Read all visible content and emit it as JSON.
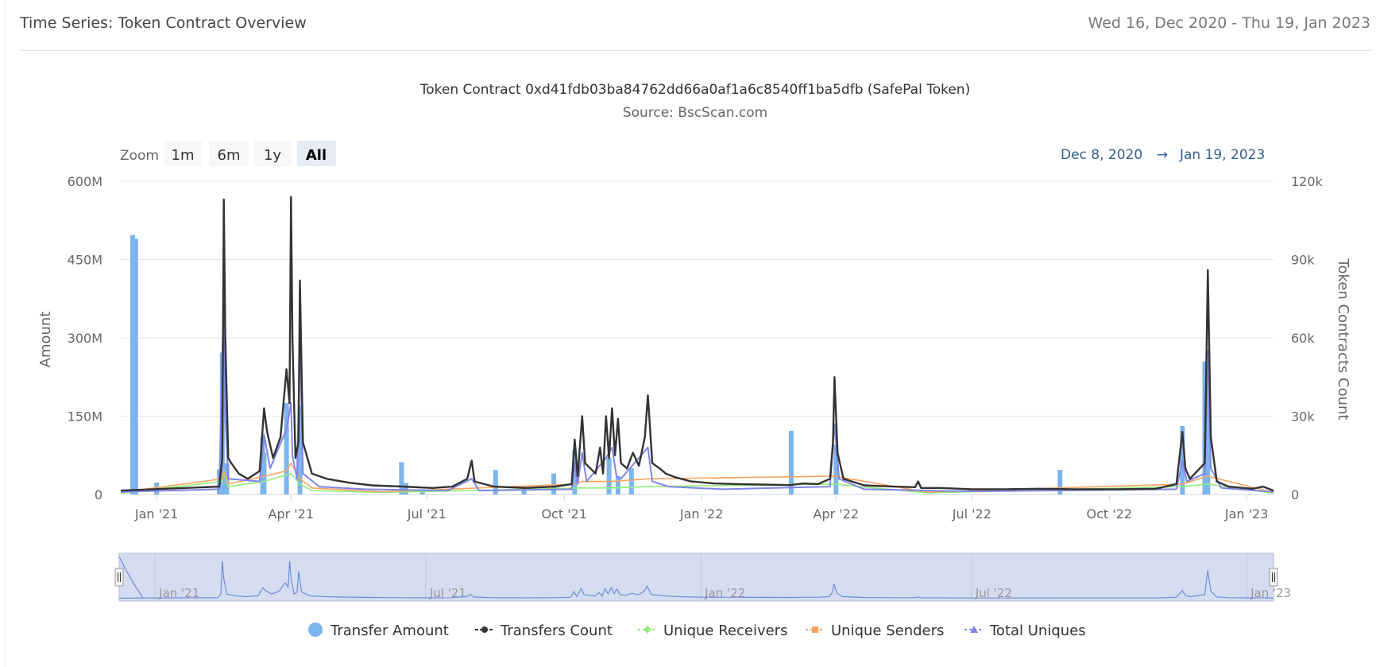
{
  "header": {
    "title": "Time Series: Token Contract Overview",
    "date_range": "Wed 16, Dec 2020 - Thu 19, Jan 2023"
  },
  "colors": {
    "transfer_amount": "#7cb5ec",
    "transfers_count": "#333333",
    "unique_receivers": "#90ed7d",
    "unique_senders": "#f7a35c",
    "total_uniques": "#8085e9",
    "navigator_fill": "#d6dcef",
    "range_text": "#335f8a"
  },
  "zoom": {
    "label": "Zoom",
    "buttons": [
      "1m",
      "6m",
      "1y",
      "All"
    ],
    "selected": "All"
  },
  "range_selector": {
    "from": "Dec 8, 2020",
    "arrow": "→",
    "to": "Jan 19, 2023"
  },
  "chart_data": {
    "type": "line",
    "title": "Token Contract 0xd41fdb03ba84762dd66a0af1a6c8540ff1ba5dfb (SafePal Token)",
    "subtitle": "Source: BscScan.com",
    "xlim": [
      "2020-12-08",
      "2023-01-19"
    ],
    "x_ticks": [
      {
        "date": "2021-01-01",
        "label": "Jan '21"
      },
      {
        "date": "2021-04-01",
        "label": "Apr '21"
      },
      {
        "date": "2021-07-01",
        "label": "Jul '21"
      },
      {
        "date": "2021-10-01",
        "label": "Oct '21"
      },
      {
        "date": "2022-01-01",
        "label": "Jan '22"
      },
      {
        "date": "2022-04-01",
        "label": "Apr '22"
      },
      {
        "date": "2022-07-01",
        "label": "Jul '22"
      },
      {
        "date": "2022-10-01",
        "label": "Oct '22"
      },
      {
        "date": "2023-01-01",
        "label": "Jan '23"
      }
    ],
    "y_left": {
      "label": "Amount",
      "min": 0,
      "max": 600000000,
      "ticks": [
        0,
        150000000,
        300000000,
        450000000,
        600000000
      ],
      "tick_labels": [
        "0",
        "150M",
        "300M",
        "450M",
        "600M"
      ]
    },
    "y_right": {
      "label": "Token Contracts Count",
      "min": 0,
      "max": 120000,
      "ticks": [
        0,
        30000,
        60000,
        90000,
        120000
      ],
      "tick_labels": [
        "0",
        "30k",
        "60k",
        "90k",
        "120k"
      ]
    },
    "navigator_ticks": [
      {
        "date": "2021-01-01",
        "label": "Jan '21"
      },
      {
        "date": "2021-07-01",
        "label": "Jul '21"
      },
      {
        "date": "2022-01-01",
        "label": "Jan '22"
      },
      {
        "date": "2022-07-01",
        "label": "Jul '22"
      },
      {
        "date": "2023-01-01",
        "label": "Jan '23"
      }
    ],
    "series": [
      {
        "name": "Transfer Amount",
        "type": "column",
        "axis": "left",
        "points": [
          [
            "2020-12-16",
            497000000
          ],
          [
            "2020-12-18",
            490000000
          ],
          [
            "2021-01-01",
            23000000
          ],
          [
            "2021-02-12",
            48000000
          ],
          [
            "2021-02-14",
            272000000
          ],
          [
            "2021-02-17",
            60000000
          ],
          [
            "2021-03-13",
            110000000
          ],
          [
            "2021-03-14",
            80000000
          ],
          [
            "2021-03-29",
            175000000
          ],
          [
            "2021-04-07",
            170000000
          ],
          [
            "2021-06-14",
            62000000
          ],
          [
            "2021-06-17",
            22000000
          ],
          [
            "2021-06-28",
            10000000
          ],
          [
            "2021-08-16",
            47000000
          ],
          [
            "2021-09-04",
            15000000
          ],
          [
            "2021-09-24",
            40000000
          ],
          [
            "2021-10-08",
            85000000
          ],
          [
            "2021-10-31",
            70000000
          ],
          [
            "2021-11-06",
            35000000
          ],
          [
            "2021-11-15",
            50000000
          ],
          [
            "2022-03-02",
            122000000
          ],
          [
            "2022-04-01",
            95000000
          ],
          [
            "2022-08-29",
            47000000
          ],
          [
            "2022-11-19",
            131000000
          ],
          [
            "2022-12-04",
            255000000
          ],
          [
            "2022-12-06",
            270000000
          ]
        ]
      },
      {
        "name": "Transfers Count",
        "type": "line",
        "axis": "right",
        "baseline": 1500,
        "points": [
          [
            "2021-02-12",
            3000
          ],
          [
            "2021-02-14",
            14000
          ],
          [
            "2021-02-15",
            113000
          ],
          [
            "2021-02-16",
            60000
          ],
          [
            "2021-02-18",
            14000
          ],
          [
            "2021-02-20",
            12000
          ],
          [
            "2021-02-25",
            8000
          ],
          [
            "2021-03-03",
            6000
          ],
          [
            "2021-03-11",
            9000
          ],
          [
            "2021-03-14",
            33000
          ],
          [
            "2021-03-16",
            24000
          ],
          [
            "2021-03-20",
            14000
          ],
          [
            "2021-03-25",
            22000
          ],
          [
            "2021-03-29",
            48000
          ],
          [
            "2021-03-31",
            35000
          ],
          [
            "2021-04-01",
            114000
          ],
          [
            "2021-04-02",
            60000
          ],
          [
            "2021-04-04",
            14000
          ],
          [
            "2021-04-06",
            20000
          ],
          [
            "2021-04-07",
            82000
          ],
          [
            "2021-04-09",
            20000
          ],
          [
            "2021-04-15",
            8000
          ],
          [
            "2021-04-25",
            6000
          ],
          [
            "2021-05-10",
            4500
          ],
          [
            "2021-05-25",
            3500
          ],
          [
            "2021-06-15",
            3000
          ],
          [
            "2021-07-05",
            2500
          ],
          [
            "2021-07-18",
            3000
          ],
          [
            "2021-07-28",
            6000
          ],
          [
            "2021-07-31",
            13000
          ],
          [
            "2021-08-02",
            5000
          ],
          [
            "2021-08-15",
            3000
          ],
          [
            "2021-09-05",
            2500
          ],
          [
            "2021-09-25",
            3000
          ],
          [
            "2021-10-06",
            4000
          ],
          [
            "2021-10-08",
            21000
          ],
          [
            "2021-10-10",
            7000
          ],
          [
            "2021-10-13",
            30000
          ],
          [
            "2021-10-15",
            12000
          ],
          [
            "2021-10-22",
            8000
          ],
          [
            "2021-10-25",
            18000
          ],
          [
            "2021-10-27",
            8000
          ],
          [
            "2021-10-29",
            30000
          ],
          [
            "2021-10-31",
            14000
          ],
          [
            "2021-11-02",
            33000
          ],
          [
            "2021-11-04",
            15000
          ],
          [
            "2021-11-06",
            29000
          ],
          [
            "2021-11-08",
            12000
          ],
          [
            "2021-11-12",
            10000
          ],
          [
            "2021-11-16",
            16000
          ],
          [
            "2021-11-20",
            11000
          ],
          [
            "2021-11-24",
            22000
          ],
          [
            "2021-11-26",
            38000
          ],
          [
            "2021-11-29",
            12000
          ],
          [
            "2021-12-05",
            9500
          ],
          [
            "2021-12-08",
            8000
          ],
          [
            "2021-12-15",
            6500
          ],
          [
            "2021-12-25",
            5000
          ],
          [
            "2022-01-10",
            4200
          ],
          [
            "2022-01-25",
            4000
          ],
          [
            "2022-02-10",
            3800
          ],
          [
            "2022-03-01",
            3600
          ],
          [
            "2022-03-10",
            4200
          ],
          [
            "2022-03-20",
            4000
          ],
          [
            "2022-03-28",
            6000
          ],
          [
            "2022-03-30",
            20000
          ],
          [
            "2022-03-31",
            45000
          ],
          [
            "2022-04-02",
            16000
          ],
          [
            "2022-04-06",
            6000
          ],
          [
            "2022-04-20",
            3500
          ],
          [
            "2022-05-10",
            3000
          ],
          [
            "2022-05-24",
            2800
          ],
          [
            "2022-05-26",
            5000
          ],
          [
            "2022-05-28",
            2500
          ],
          [
            "2022-06-10",
            2500
          ],
          [
            "2022-07-01",
            2000
          ],
          [
            "2022-07-25",
            2000
          ],
          [
            "2022-08-15",
            2200
          ],
          [
            "2022-09-10",
            2000
          ],
          [
            "2022-10-05",
            2000
          ],
          [
            "2022-11-01",
            2200
          ],
          [
            "2022-11-15",
            4000
          ],
          [
            "2022-11-19",
            24000
          ],
          [
            "2022-11-21",
            10000
          ],
          [
            "2022-11-24",
            6000
          ],
          [
            "2022-12-04",
            12000
          ],
          [
            "2022-12-06",
            86000
          ],
          [
            "2022-12-08",
            22000
          ],
          [
            "2022-12-12",
            5000
          ],
          [
            "2022-12-20",
            3000
          ],
          [
            "2023-01-05",
            2200
          ],
          [
            "2023-01-12",
            3000
          ],
          [
            "2023-01-19",
            1500
          ]
        ]
      },
      {
        "name": "Unique Receivers",
        "type": "line",
        "axis": "right",
        "baseline": 500,
        "points": [
          [
            "2021-02-14",
            5000
          ],
          [
            "2021-02-15",
            8000
          ],
          [
            "2021-02-18",
            3000
          ],
          [
            "2021-03-14",
            5000
          ],
          [
            "2021-04-01",
            8000
          ],
          [
            "2021-04-07",
            4000
          ],
          [
            "2021-04-15",
            1500
          ],
          [
            "2021-06-01",
            800
          ],
          [
            "2021-10-13",
            2500
          ],
          [
            "2021-11-02",
            2500
          ],
          [
            "2021-11-26",
            3000
          ],
          [
            "2022-03-31",
            4000
          ],
          [
            "2022-06-01",
            600
          ],
          [
            "2022-11-19",
            3000
          ],
          [
            "2022-12-06",
            4000
          ],
          [
            "2023-01-19",
            500
          ]
        ]
      },
      {
        "name": "Unique Senders",
        "type": "line",
        "axis": "right",
        "baseline": 800,
        "points": [
          [
            "2021-02-14",
            6000
          ],
          [
            "2021-02-15",
            9000
          ],
          [
            "2021-02-18",
            4000
          ],
          [
            "2021-03-14",
            7000
          ],
          [
            "2021-03-29",
            9000
          ],
          [
            "2021-04-01",
            12000
          ],
          [
            "2021-04-07",
            6000
          ],
          [
            "2021-04-15",
            2500
          ],
          [
            "2021-06-01",
            1000
          ],
          [
            "2021-10-08",
            4000
          ],
          [
            "2021-10-13",
            5000
          ],
          [
            "2021-11-02",
            5000
          ],
          [
            "2021-11-26",
            6000
          ],
          [
            "2022-03-31",
            7000
          ],
          [
            "2022-06-01",
            900
          ],
          [
            "2022-11-19",
            4000
          ],
          [
            "2022-12-06",
            7000
          ],
          [
            "2023-01-19",
            800
          ]
        ]
      },
      {
        "name": "Total Uniques",
        "type": "line",
        "axis": "right",
        "baseline": 1000,
        "points": [
          [
            "2021-02-12",
            2000
          ],
          [
            "2021-02-15",
            79000
          ],
          [
            "2021-02-16",
            30000
          ],
          [
            "2021-02-18",
            6000
          ],
          [
            "2021-03-11",
            5000
          ],
          [
            "2021-03-14",
            23000
          ],
          [
            "2021-03-18",
            10000
          ],
          [
            "2021-03-29",
            25000
          ],
          [
            "2021-04-01",
            35000
          ],
          [
            "2021-04-02",
            15000
          ],
          [
            "2021-04-05",
            6000
          ],
          [
            "2021-04-07",
            62000
          ],
          [
            "2021-04-09",
            8000
          ],
          [
            "2021-04-20",
            3000
          ],
          [
            "2021-05-20",
            2000
          ],
          [
            "2021-07-15",
            1500
          ],
          [
            "2021-07-31",
            6000
          ],
          [
            "2021-08-05",
            1500
          ],
          [
            "2021-10-06",
            2000
          ],
          [
            "2021-10-08",
            12000
          ],
          [
            "2021-10-10",
            4000
          ],
          [
            "2021-10-13",
            16000
          ],
          [
            "2021-10-16",
            5000
          ],
          [
            "2021-10-29",
            14000
          ],
          [
            "2021-11-02",
            18000
          ],
          [
            "2021-11-05",
            7000
          ],
          [
            "2021-11-08",
            6000
          ],
          [
            "2021-11-26",
            18000
          ],
          [
            "2021-11-29",
            5000
          ],
          [
            "2021-12-10",
            3000
          ],
          [
            "2022-01-15",
            2000
          ],
          [
            "2022-03-28",
            3000
          ],
          [
            "2022-03-31",
            27000
          ],
          [
            "2022-04-03",
            6000
          ],
          [
            "2022-04-20",
            2000
          ],
          [
            "2022-07-01",
            1200
          ],
          [
            "2022-11-15",
            2000
          ],
          [
            "2022-11-19",
            13000
          ],
          [
            "2022-11-22",
            5000
          ],
          [
            "2022-12-04",
            8000
          ],
          [
            "2022-12-06",
            55000
          ],
          [
            "2022-12-08",
            10000
          ],
          [
            "2022-12-15",
            2500
          ],
          [
            "2023-01-19",
            1000
          ]
        ]
      }
    ],
    "legend": {
      "position": "bottom",
      "items": [
        "Transfer Amount",
        "Transfers Count",
        "Unique Receivers",
        "Unique Senders",
        "Total Uniques"
      ]
    },
    "grid": true
  }
}
